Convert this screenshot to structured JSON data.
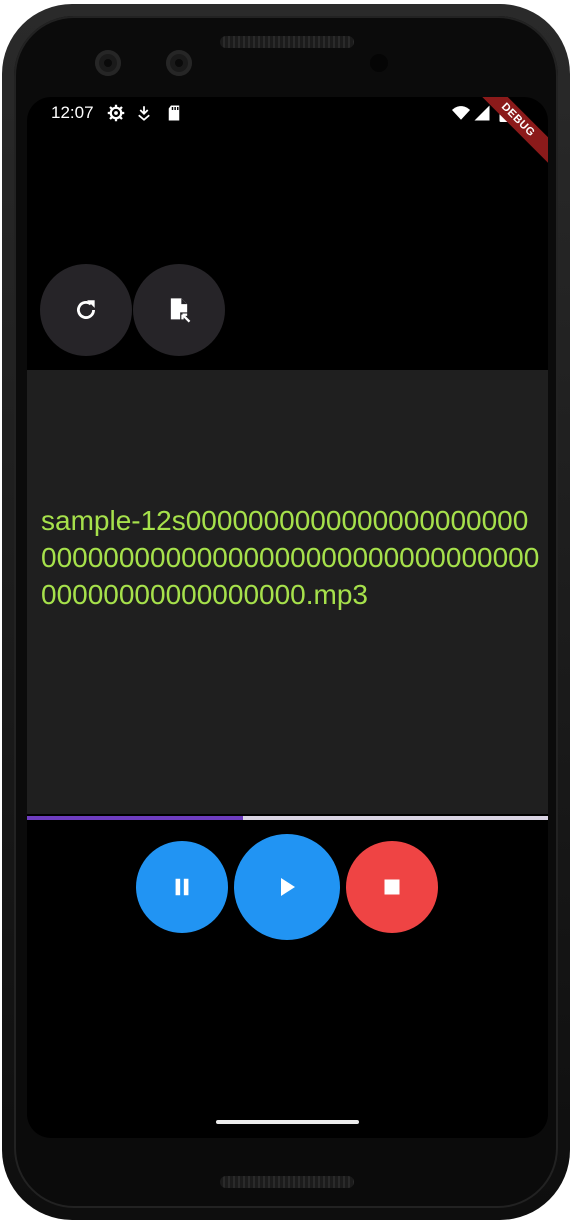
{
  "status_bar": {
    "time": "12:07",
    "left_icons": [
      "settings-gear-icon",
      "download-arrow-icon",
      "sd-card-icon"
    ],
    "right_icons": [
      "wifi-icon",
      "signal-icon",
      "battery-icon"
    ]
  },
  "debug_banner": {
    "label": "DEBUG",
    "color": "#8b1a1a"
  },
  "toolbar": {
    "buttons": [
      {
        "name": "refresh-button",
        "icon": "refresh-icon"
      },
      {
        "name": "open-file-button",
        "icon": "file-open-icon"
      }
    ]
  },
  "file": {
    "name": "sample-12s00000000000000000000000000000000000000000000000000000000000000000000000.mp3",
    "text_color": "#a6e14b"
  },
  "progress": {
    "value": 0.415,
    "fill_color": "#6e3dbf",
    "track_color": "#d9d3e3"
  },
  "controls": [
    {
      "name": "pause-button",
      "icon": "pause-icon",
      "color": "#2194f3"
    },
    {
      "name": "play-button",
      "icon": "play-icon",
      "color": "#2194f3"
    },
    {
      "name": "stop-button",
      "icon": "stop-icon",
      "color": "#ef4444"
    }
  ]
}
